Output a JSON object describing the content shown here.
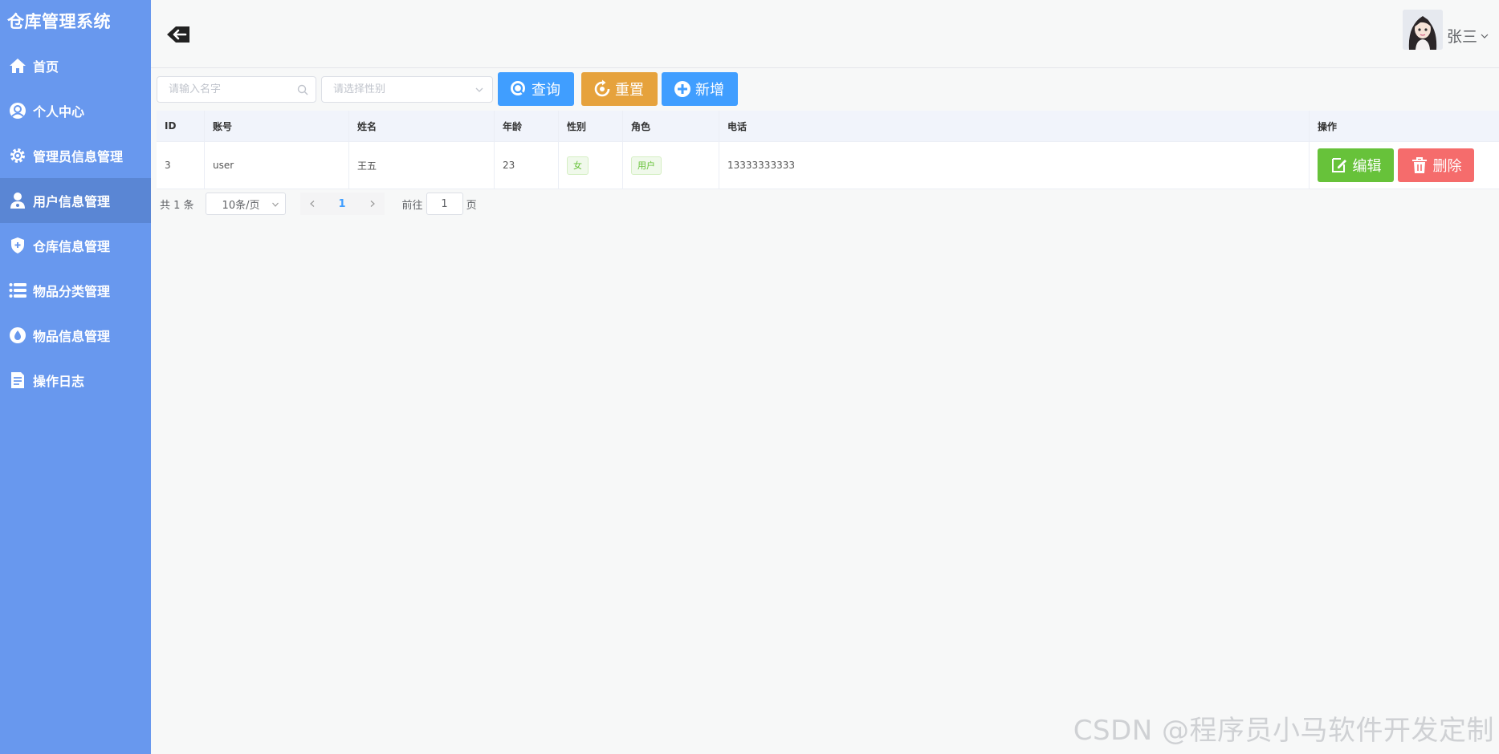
{
  "app": {
    "title": "仓库管理系统"
  },
  "sidebar": {
    "items": [
      {
        "label": "首页",
        "icon": "home-icon",
        "active": false
      },
      {
        "label": "个人中心",
        "icon": "user-circle-icon",
        "active": false
      },
      {
        "label": "管理员信息管理",
        "icon": "gear-icon",
        "active": false
      },
      {
        "label": "用户信息管理",
        "icon": "user-icon",
        "active": true
      },
      {
        "label": "仓库信息管理",
        "icon": "shield-icon",
        "active": false
      },
      {
        "label": "物品分类管理",
        "icon": "list-icon",
        "active": false
      },
      {
        "label": "物品信息管理",
        "icon": "drop-icon",
        "active": false
      },
      {
        "label": "操作日志",
        "icon": "document-icon",
        "active": false
      }
    ],
    "colors": {
      "background": "#6898ee",
      "active": "#5a86d4"
    }
  },
  "header": {
    "user_name": "张三"
  },
  "search": {
    "name_placeholder": "请输入名字",
    "sex_placeholder": "请选择性别",
    "query_label": "查询",
    "reset_label": "重置",
    "add_label": "新增"
  },
  "table": {
    "columns": [
      "ID",
      "账号",
      "姓名",
      "年龄",
      "性别",
      "角色",
      "电话",
      "操作"
    ],
    "rows": [
      {
        "id": "3",
        "account": "user",
        "name": "王五",
        "age": "23",
        "sex": "女",
        "role": "用户",
        "phone": "13333333333"
      }
    ],
    "edit_label": "编辑",
    "delete_label": "删除"
  },
  "pagination": {
    "total_text": "共 1 条",
    "page_size": "10条/页",
    "current_page": "1",
    "goto_prefix": "前往",
    "goto_value": "1",
    "goto_suffix": "页"
  },
  "watermark": "CSDN @程序员小马软件开发定制",
  "colors": {
    "primary": "#409eff",
    "warning": "#e6a23c",
    "success": "#67c23a",
    "danger": "#f56c6c"
  }
}
